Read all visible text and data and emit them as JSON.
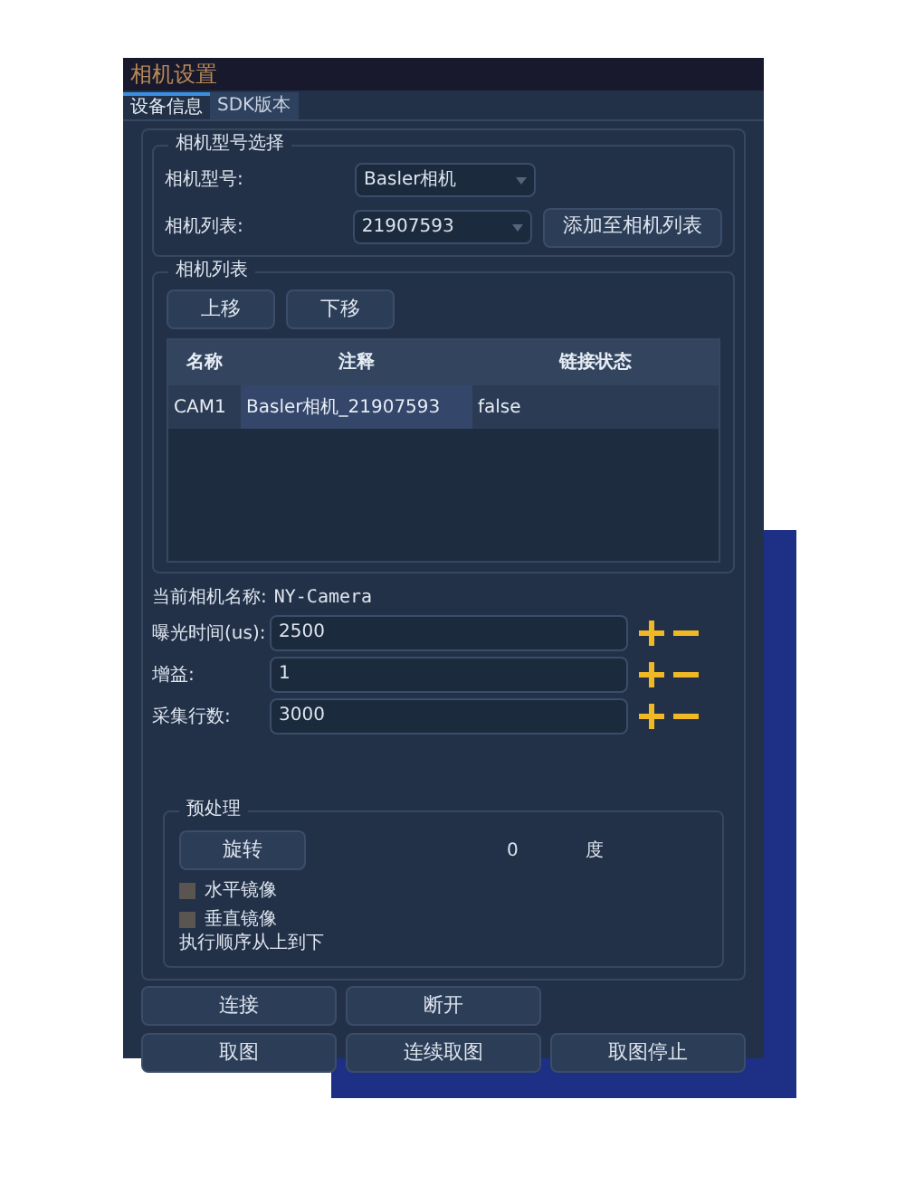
{
  "window": {
    "title": "相机设置"
  },
  "tabs": [
    {
      "label": "设备信息",
      "selected": true
    },
    {
      "label": "SDK版本",
      "selected": false
    }
  ],
  "model_group": {
    "title": "相机型号选择",
    "rows": [
      {
        "label": "相机型号:",
        "value": "Basler相机"
      },
      {
        "label": "相机列表:",
        "value": "21907593"
      }
    ],
    "add_button": "添加至相机列表"
  },
  "camera_list": {
    "title": "相机列表",
    "buttons": [
      "上移",
      "下移"
    ],
    "table": {
      "columns": [
        "名称",
        "注释",
        "链接状态"
      ],
      "rows": [
        {
          "cells": [
            "CAM1",
            "Basler相机_21907593",
            "false"
          ],
          "selected": true
        }
      ]
    }
  },
  "current_camera": {
    "label": "当前相机名称:",
    "value": "NY-Camera"
  },
  "params": [
    {
      "label": "曝光时间(us):",
      "value": "2500"
    },
    {
      "label": "增益:",
      "value": "1"
    },
    {
      "label": "采集行数:",
      "value": "3000"
    }
  ],
  "preprocess": {
    "title": "预处理",
    "rotate_button": "旋转",
    "angle": "0",
    "unit": "度",
    "options": [
      {
        "label": "水平镜像",
        "checked": false
      },
      {
        "label": "垂直镜像",
        "checked": false
      }
    ],
    "note": "执行顺序从上到下"
  },
  "actions": [
    [
      "连接",
      "断开"
    ],
    [
      "取图",
      "连续取图",
      "取图停止"
    ]
  ]
}
